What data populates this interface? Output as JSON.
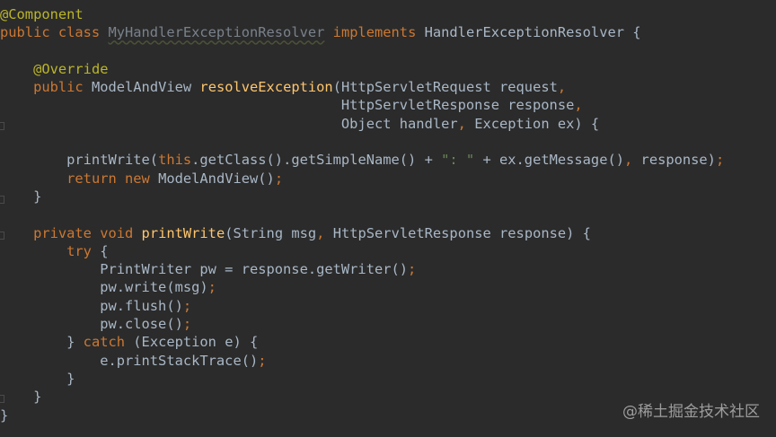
{
  "watermark": "@稀土掘金技术社区",
  "lines": [
    [
      {
        "t": "@Component",
        "c": "ann"
      }
    ],
    [
      {
        "t": "public class ",
        "c": "kw"
      },
      {
        "t": "MyHandlerExceptionResolver",
        "c": "un"
      },
      {
        "t": " ",
        "c": "pl"
      },
      {
        "t": "implements ",
        "c": "kw"
      },
      {
        "t": "HandlerExceptionResolver {",
        "c": "pl"
      }
    ],
    [],
    [
      {
        "t": "    ",
        "c": "pl"
      },
      {
        "t": "@Override",
        "c": "ann"
      }
    ],
    [
      {
        "t": "    ",
        "c": "pl"
      },
      {
        "t": "public ",
        "c": "kw"
      },
      {
        "t": "ModelAndView ",
        "c": "pl"
      },
      {
        "t": "resolveException",
        "c": "fn"
      },
      {
        "t": "(HttpServletRequest request",
        "c": "pl"
      },
      {
        "t": ",",
        "c": "kw"
      }
    ],
    [
      {
        "t": "                                         HttpServletResponse response",
        "c": "pl"
      },
      {
        "t": ",",
        "c": "kw"
      }
    ],
    [
      {
        "t": "                                         Object handler",
        "c": "pl"
      },
      {
        "t": ", ",
        "c": "kw"
      },
      {
        "t": "Exception ex) {",
        "c": "pl"
      }
    ],
    [],
    [
      {
        "t": "        printWrite(",
        "c": "pl"
      },
      {
        "t": "this",
        "c": "kw"
      },
      {
        "t": ".getClass().getSimpleName() + ",
        "c": "pl"
      },
      {
        "t": "\": \"",
        "c": "str"
      },
      {
        "t": " + ex.getMessage()",
        "c": "pl"
      },
      {
        "t": ", ",
        "c": "kw"
      },
      {
        "t": "response)",
        "c": "pl"
      },
      {
        "t": ";",
        "c": "kw"
      }
    ],
    [
      {
        "t": "        ",
        "c": "pl"
      },
      {
        "t": "return new ",
        "c": "kw"
      },
      {
        "t": "ModelAndView()",
        "c": "pl"
      },
      {
        "t": ";",
        "c": "kw"
      }
    ],
    [
      {
        "t": "    }",
        "c": "pl"
      }
    ],
    [],
    [
      {
        "t": "    ",
        "c": "pl"
      },
      {
        "t": "private void ",
        "c": "kw"
      },
      {
        "t": "printWrite",
        "c": "fn"
      },
      {
        "t": "(String msg",
        "c": "pl"
      },
      {
        "t": ", ",
        "c": "kw"
      },
      {
        "t": "HttpServletResponse response) {",
        "c": "pl"
      }
    ],
    [
      {
        "t": "        ",
        "c": "pl"
      },
      {
        "t": "try ",
        "c": "kw"
      },
      {
        "t": "{",
        "c": "pl"
      }
    ],
    [
      {
        "t": "            PrintWriter pw = response.getWriter()",
        "c": "pl"
      },
      {
        "t": ";",
        "c": "kw"
      }
    ],
    [
      {
        "t": "            pw.write(msg)",
        "c": "pl"
      },
      {
        "t": ";",
        "c": "kw"
      }
    ],
    [
      {
        "t": "            pw.flush()",
        "c": "pl"
      },
      {
        "t": ";",
        "c": "kw"
      }
    ],
    [
      {
        "t": "            pw.close()",
        "c": "pl"
      },
      {
        "t": ";",
        "c": "kw"
      }
    ],
    [
      {
        "t": "        } ",
        "c": "pl"
      },
      {
        "t": "catch ",
        "c": "kw"
      },
      {
        "t": "(Exception e) {",
        "c": "pl"
      }
    ],
    [
      {
        "t": "            e.printStackTrace()",
        "c": "pl"
      },
      {
        "t": ";",
        "c": "kw"
      }
    ],
    [
      {
        "t": "        }",
        "c": "pl"
      }
    ],
    [
      {
        "t": "    }",
        "c": "pl"
      }
    ],
    [
      {
        "t": "}",
        "c": "pl"
      }
    ]
  ]
}
